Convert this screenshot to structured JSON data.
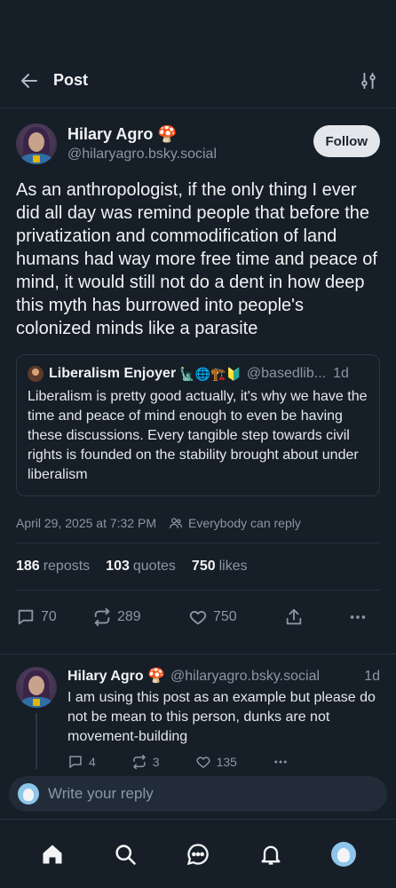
{
  "header": {
    "title": "Post"
  },
  "post": {
    "author_name": "Hilary Agro 🍄",
    "author_handle": "@hilaryagro.bsky.social",
    "follow_label": "Follow",
    "text": "As an anthropologist, if the only thing I ever did all day was remind people that before the privatization and commodification of land humans had way more free time and peace of mind, it would still not do a dent in how deep this myth has burrowed into people's colonized minds like a parasite",
    "quote": {
      "author_name": "Liberalism Enjoyer",
      "emojis": "🗽🌐🏗️🔰",
      "author_handle": "@basedlib...",
      "time": "1d",
      "text": "Liberalism is pretty good actually, it's why we have the time and peace of mind enough to even be having these discussions. Every tangible step towards civil rights is founded on the stability brought about under liberalism"
    },
    "timestamp": "April 29, 2025 at 7:32 PM",
    "reply_setting": "Everybody can reply",
    "stats": {
      "reposts_count": "186",
      "reposts_label": "reposts",
      "quotes_count": "103",
      "quotes_label": "quotes",
      "likes_count": "750",
      "likes_label": "likes"
    },
    "actions": {
      "replies": "70",
      "reposts": "289",
      "likes": "750"
    }
  },
  "reply": {
    "author_name": "Hilary Agro 🍄",
    "author_handle": "@hilaryagro.bsky.social",
    "time": "1d",
    "text": "I am using this post as an example but please do not be mean to this person, dunks are not movement-building",
    "replies": "4",
    "reposts": "3",
    "likes": "135"
  },
  "composer": {
    "placeholder": "Write your reply"
  },
  "colors": {
    "background": "#161e27",
    "text": "#f1f3f5",
    "muted": "#8b97a6",
    "divider": "#27313d"
  }
}
